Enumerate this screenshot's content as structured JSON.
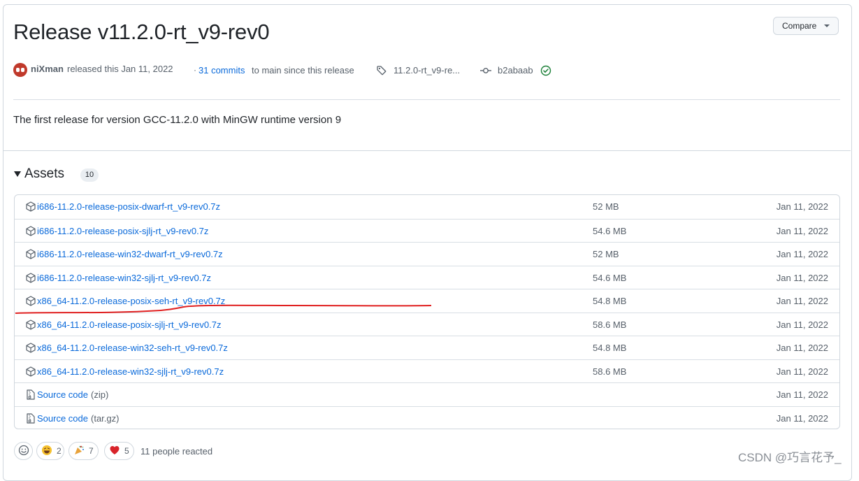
{
  "release": {
    "title": "Release v11.2.0-rt_v9-rev0",
    "compare_label": "Compare",
    "author": "niXman",
    "released_text": "released this Jan 11, 2022",
    "dot": "·",
    "commits_link": "31 commits",
    "commits_rest": "to main since this release",
    "tag": "11.2.0-rt_v9-re...",
    "commit": "b2abaab",
    "description": "The first release for version GCC-11.2.0 with MinGW runtime version 9"
  },
  "assets": {
    "label": "Assets",
    "count": "10",
    "items": [
      {
        "name": "i686-11.2.0-release-posix-dwarf-rt_v9-rev0.7z",
        "size": "52 MB",
        "date": "Jan 11, 2022",
        "icon": "package-icon"
      },
      {
        "name": "i686-11.2.0-release-posix-sjlj-rt_v9-rev0.7z",
        "size": "54.6 MB",
        "date": "Jan 11, 2022",
        "icon": "package-icon"
      },
      {
        "name": "i686-11.2.0-release-win32-dwarf-rt_v9-rev0.7z",
        "size": "52 MB",
        "date": "Jan 11, 2022",
        "icon": "package-icon"
      },
      {
        "name": "i686-11.2.0-release-win32-sjlj-rt_v9-rev0.7z",
        "size": "54.6 MB",
        "date": "Jan 11, 2022",
        "icon": "package-icon"
      },
      {
        "name": "x86_64-11.2.0-release-posix-seh-rt_v9-rev0.7z",
        "size": "54.8 MB",
        "date": "Jan 11, 2022",
        "icon": "package-icon"
      },
      {
        "name": "x86_64-11.2.0-release-posix-sjlj-rt_v9-rev0.7z",
        "size": "58.6 MB",
        "date": "Jan 11, 2022",
        "icon": "package-icon"
      },
      {
        "name": "x86_64-11.2.0-release-win32-seh-rt_v9-rev0.7z",
        "size": "54.8 MB",
        "date": "Jan 11, 2022",
        "icon": "package-icon"
      },
      {
        "name": "x86_64-11.2.0-release-win32-sjlj-rt_v9-rev0.7z",
        "size": "58.6 MB",
        "date": "Jan 11, 2022",
        "icon": "package-icon"
      },
      {
        "name": "Source code",
        "paren": "(zip)",
        "size": "",
        "date": "Jan 11, 2022",
        "icon": "file-zip-icon"
      },
      {
        "name": "Source code",
        "paren": "(tar.gz)",
        "size": "",
        "date": "Jan 11, 2022",
        "icon": "file-zip-icon"
      }
    ]
  },
  "reactions": {
    "laugh_count": "2",
    "hooray_count": "7",
    "heart_count": "5",
    "summary": "11 people reacted"
  },
  "watermark": "CSDN @巧言花予_",
  "colors": {
    "link": "#0969da",
    "annotation_red": "#e02020",
    "verified_green": "#1a7f37"
  }
}
